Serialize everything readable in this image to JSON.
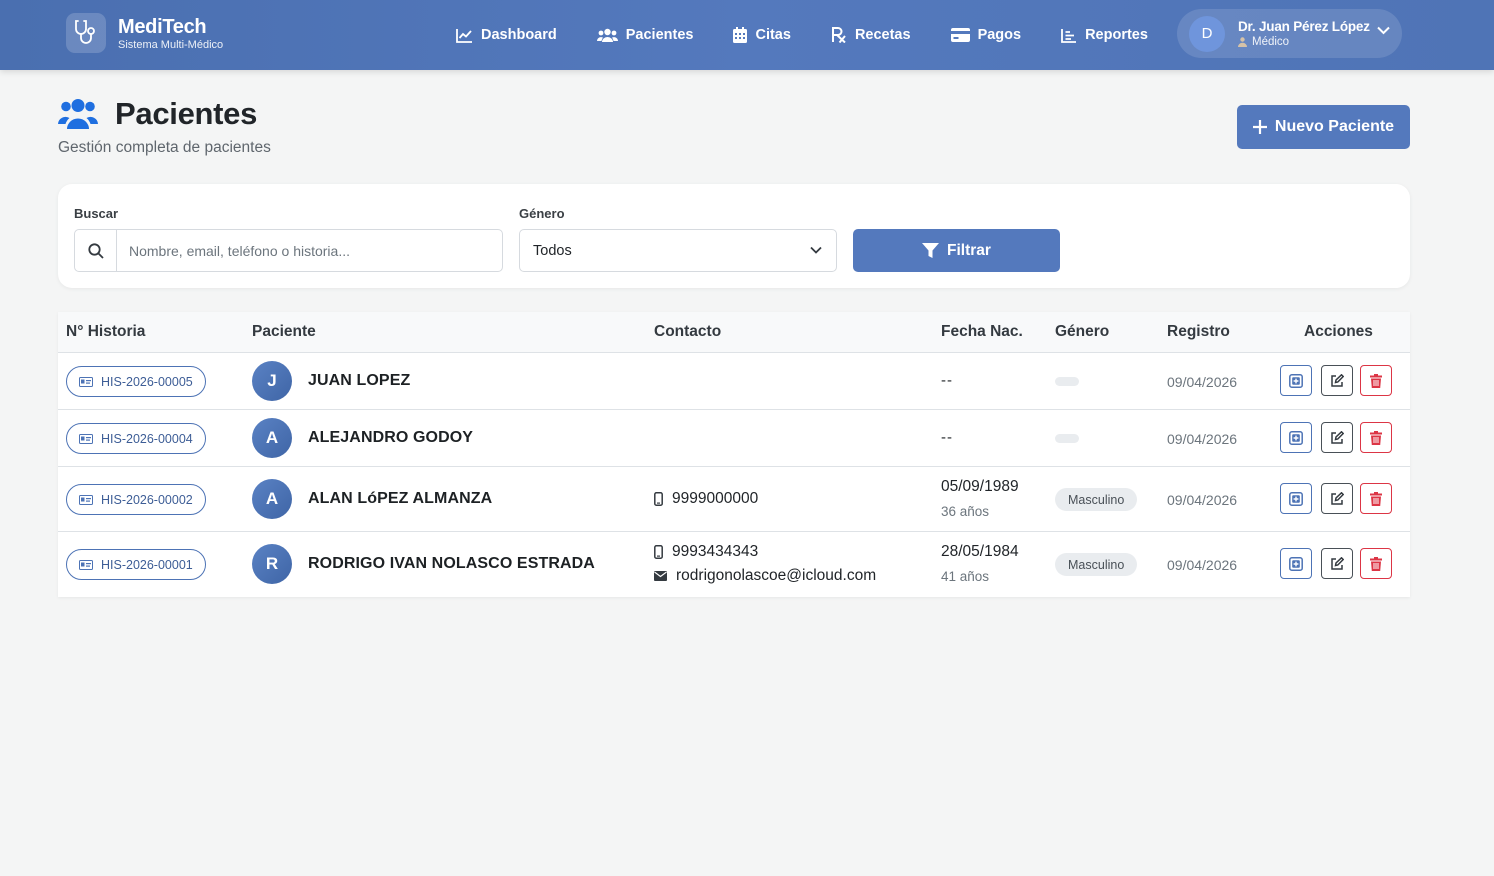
{
  "app": {
    "name": "MediTech",
    "subtitle": "Sistema Multi-Médico"
  },
  "nav": {
    "items": [
      {
        "label": "Dashboard",
        "icon": "chart-line-icon"
      },
      {
        "label": "Pacientes",
        "icon": "users-icon"
      },
      {
        "label": "Citas",
        "icon": "calendar-icon"
      },
      {
        "label": "Recetas",
        "icon": "prescription-icon"
      },
      {
        "label": "Pagos",
        "icon": "credit-card-icon"
      },
      {
        "label": "Reportes",
        "icon": "bar-chart-icon"
      }
    ]
  },
  "user": {
    "initial": "D",
    "name": "Dr. Juan Pérez López",
    "role": "Médico"
  },
  "page": {
    "title": "Pacientes",
    "subtitle": "Gestión completa de pacientes",
    "new_button": "Nuevo Paciente"
  },
  "filters": {
    "search_label": "Buscar",
    "search_placeholder": "Nombre, email, teléfono o historia...",
    "gender_label": "Género",
    "gender_selected": "Todos",
    "filter_button": "Filtrar"
  },
  "table": {
    "headers": [
      "N° Historia",
      "Paciente",
      "Contacto",
      "Fecha Nac.",
      "Género",
      "Registro",
      "Acciones"
    ],
    "rows": [
      {
        "historia": "HIS-2026-00005",
        "initial": "J",
        "name": "JUAN LOPEZ",
        "phone": "",
        "email": "",
        "dob": "--",
        "age": "",
        "gender": "",
        "registro": "09/04/2026"
      },
      {
        "historia": "HIS-2026-00004",
        "initial": "A",
        "name": "ALEJANDRO GODOY",
        "phone": "",
        "email": "",
        "dob": "--",
        "age": "",
        "gender": "",
        "registro": "09/04/2026"
      },
      {
        "historia": "HIS-2026-00002",
        "initial": "A",
        "name": "ALAN LóPEZ ALMANZA",
        "phone": "9999000000",
        "email": "",
        "dob": "05/09/1989",
        "age": "36 años",
        "gender": "Masculino",
        "registro": "09/04/2026"
      },
      {
        "historia": "HIS-2026-00001",
        "initial": "R",
        "name": "RODRIGO IVAN NOLASCO ESTRADA",
        "phone": "9993434343",
        "email": "rodrigonolascoe@icloud.com",
        "dob": "28/05/1984",
        "age": "41 años",
        "gender": "Masculino",
        "registro": "09/04/2026"
      }
    ]
  },
  "colors": {
    "primary": "#5479bd",
    "danger": "#dc3545",
    "page_icon": "#1f6fe0"
  }
}
